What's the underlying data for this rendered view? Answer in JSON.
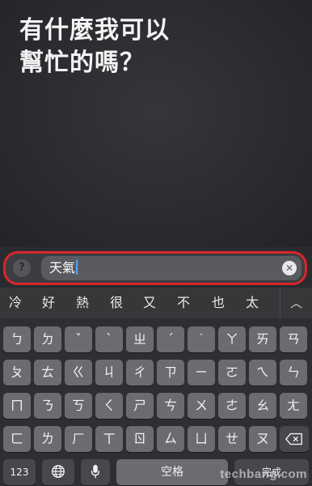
{
  "siri": {
    "prompt_line1": "有什麼我可以",
    "prompt_line2": "幫忙的嗎？"
  },
  "input": {
    "help_label": "?",
    "value": "天氣",
    "clear_label": "✕"
  },
  "candidates": [
    "冷",
    "好",
    "熱",
    "很",
    "又",
    "不",
    "也",
    "太"
  ],
  "collapse_label": "︿",
  "keyboard": {
    "row1": [
      "ㄅ",
      "ㄉ",
      "ˇ",
      "ˋ",
      "ㄓ",
      "ˊ",
      "˙",
      "ㄚ",
      "ㄞ",
      "ㄢ"
    ],
    "row2": [
      "ㄆ",
      "ㄊ",
      "ㄍ",
      "ㄐ",
      "ㄔ",
      "ㄗ",
      "ㄧ",
      "ㄛ",
      "ㄟ",
      "ㄣ"
    ],
    "row3": [
      "ㄇ",
      "ㄋ",
      "ㄎ",
      "ㄑ",
      "ㄕ",
      "ㄘ",
      "ㄨ",
      "ㄜ",
      "ㄠ",
      "ㄤ"
    ],
    "row4": [
      "ㄈ",
      "ㄌ",
      "ㄏ",
      "ㄒ",
      "ㄖ",
      "ㄙ",
      "ㄩ",
      "ㄝ",
      "ㄡ",
      "ㄥ"
    ],
    "numbers_label": "123",
    "globe_icon": "globe-icon",
    "mic_icon": "microphone-icon",
    "space_label": "空格",
    "done_label": "完成",
    "delete_icon": "delete-icon"
  },
  "watermark": "techbang.com"
}
